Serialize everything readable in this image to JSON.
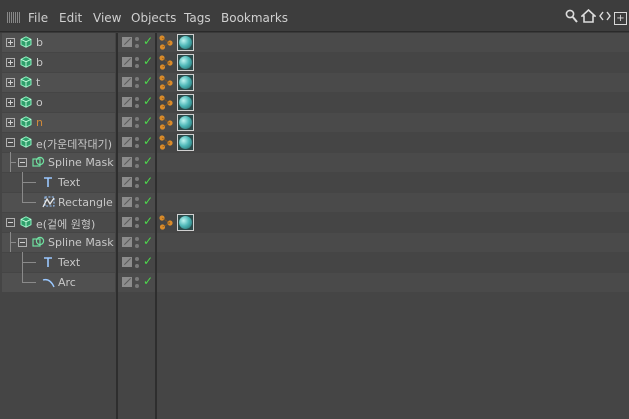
{
  "menu": [
    "File",
    "Edit",
    "View",
    "Objects",
    "Tags",
    "Bookmarks"
  ],
  "toolbar_icons": [
    "search-icon",
    "home-icon",
    "collapse-icon",
    "add-panel-icon"
  ],
  "colors": {
    "check": "#4cd94c",
    "layer_name_orange": "#d08a3a",
    "phong_tag": "#4fb8b8",
    "null_icon": "#6fe0a0"
  },
  "objects": [
    {
      "name": "b",
      "indent": 0,
      "expander": "closed",
      "icon": "null-icon",
      "tags": [
        "material-icon",
        "phong-tag-icon"
      ],
      "alt": true
    },
    {
      "name": "b",
      "indent": 0,
      "expander": "closed",
      "icon": "null-icon",
      "tags": [
        "material-icon",
        "phong-tag-icon"
      ],
      "alt": false
    },
    {
      "name": "t",
      "indent": 0,
      "expander": "closed",
      "icon": "null-icon",
      "tags": [
        "material-icon",
        "phong-tag-icon"
      ],
      "alt": true
    },
    {
      "name": "o",
      "indent": 0,
      "expander": "closed",
      "icon": "null-icon",
      "tags": [
        "material-icon",
        "phong-tag-icon"
      ],
      "alt": false
    },
    {
      "name": "n",
      "indent": 0,
      "expander": "closed",
      "icon": "null-icon",
      "tags": [
        "material-icon",
        "phong-tag-icon"
      ],
      "alt": true,
      "orange": true
    },
    {
      "name": "e(가운데작대기)",
      "indent": 0,
      "expander": "open",
      "icon": "null-icon",
      "tags": [
        "material-icon",
        "phong-tag-icon"
      ],
      "alt": false
    },
    {
      "name": "Spline Mask",
      "indent": 1,
      "expander": "open",
      "icon": "spline-mask-icon",
      "tags": [],
      "alt": true
    },
    {
      "name": "Text",
      "indent": 2,
      "expander": "none",
      "icon": "text-spline-icon",
      "tags": [],
      "alt": false
    },
    {
      "name": "Rectangle",
      "indent": 2,
      "expander": "none",
      "icon": "rectangle-spline-icon",
      "tags": [],
      "alt": true,
      "last": true
    },
    {
      "name": "e(겉에 원형)",
      "indent": 0,
      "expander": "open",
      "icon": "null-icon",
      "tags": [
        "material-icon",
        "phong-tag-icon"
      ],
      "alt": false
    },
    {
      "name": "Spline Mask",
      "indent": 1,
      "expander": "open",
      "icon": "spline-mask-icon",
      "tags": [],
      "alt": true
    },
    {
      "name": "Text",
      "indent": 2,
      "expander": "none",
      "icon": "text-spline-icon",
      "tags": [],
      "alt": false
    },
    {
      "name": "Arc",
      "indent": 2,
      "expander": "none",
      "icon": "arc-spline-icon",
      "tags": [],
      "alt": true,
      "last": true
    }
  ]
}
